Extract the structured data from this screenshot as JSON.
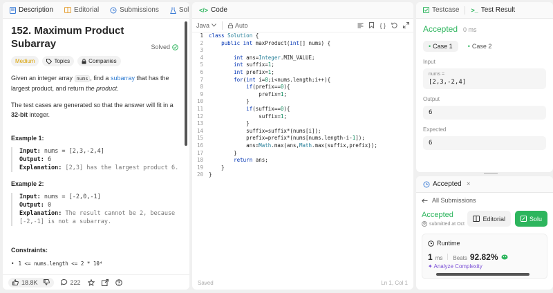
{
  "left": {
    "tabs": [
      "Description",
      "Editorial",
      "Submissions",
      "Solutions"
    ],
    "title": "152. Maximum Product Subarray",
    "status": "Solved",
    "chips": [
      "Medium",
      "Topics",
      "Companies"
    ],
    "desc_part1": "Given an integer array ",
    "desc_code": "nums",
    "desc_part2": ", find a ",
    "desc_link": "subarray",
    "desc_part3": " that has the largest product, and return ",
    "desc_em": "the product",
    "desc_part4": ".",
    "note_part1": "The test cases are generated so that the answer will fit in a ",
    "note_bold": "32-bit",
    "note_part2": " integer.",
    "ex1_title": "Example 1:",
    "ex1_input_label": "Input:",
    "ex1_input": " nums = [2,3,-2,4]",
    "ex1_output_label": "Output:",
    "ex1_output": " 6",
    "ex1_expl_label": "Explanation:",
    "ex1_expl": " [2,3] has the largest product 6.",
    "ex2_title": "Example 2:",
    "ex2_input_label": "Input:",
    "ex2_input": " nums = [-2,0,-1]",
    "ex2_output_label": "Output:",
    "ex2_output": " 0",
    "ex2_expl_label": "Explanation:",
    "ex2_expl_a": " The result cannot be 2, because",
    "ex2_expl_b": "[-2,-1] is not a subarray.",
    "constraints_title": "Constraints:",
    "constraint1": "1 <= nums.length <= 2 * 10⁴",
    "likes": "18.8K",
    "comments": "222"
  },
  "code": {
    "tab": "Code",
    "language": "Java",
    "mode": "Auto",
    "lines": [
      "class Solution {",
      "    public int maxProduct(int[] nums) {",
      "",
      "        int ans=Integer.MIN_VALUE;",
      "        int suffix=1;",
      "        int prefix=1;",
      "        for(int i=0;i<nums.length;i++){",
      "            if(prefix==0){",
      "                prefix=1;",
      "            }",
      "            if(suffix==0){",
      "                suffix=1;",
      "            }",
      "            suffix=suffix*(nums[i]);",
      "            prefix=prefix*(nums[nums.length-i-1]);",
      "            ans=Math.max(ans,Math.max(suffix,prefix));",
      "        }",
      "        return ans;",
      "    }",
      "}"
    ],
    "status_left": "Saved",
    "status_right": "Ln 1, Col 1"
  },
  "result": {
    "tabs": [
      "Testcase",
      "Test Result"
    ],
    "accepted": "Accepted",
    "runtime": "0 ms",
    "cases": [
      "Case 1",
      "Case 2"
    ],
    "input_label": "Input",
    "input_name": "nums =",
    "input_value": "[2,3,-2,4]",
    "output_label": "Output",
    "output_value": "6",
    "expected_label": "Expected",
    "expected_value": "6"
  },
  "submission": {
    "tab": "Accepted",
    "back": "All Submissions",
    "accepted": "Accepted",
    "submitted": "submitted at Oct",
    "editorial_btn": "Editorial",
    "solution_btn": "Solu",
    "runtime_title": "Runtime",
    "runtime_value": "1",
    "runtime_unit": "ms",
    "beats_label": "Beats",
    "beats_value": "92.82%",
    "analyze": "Analyze Complexity"
  }
}
